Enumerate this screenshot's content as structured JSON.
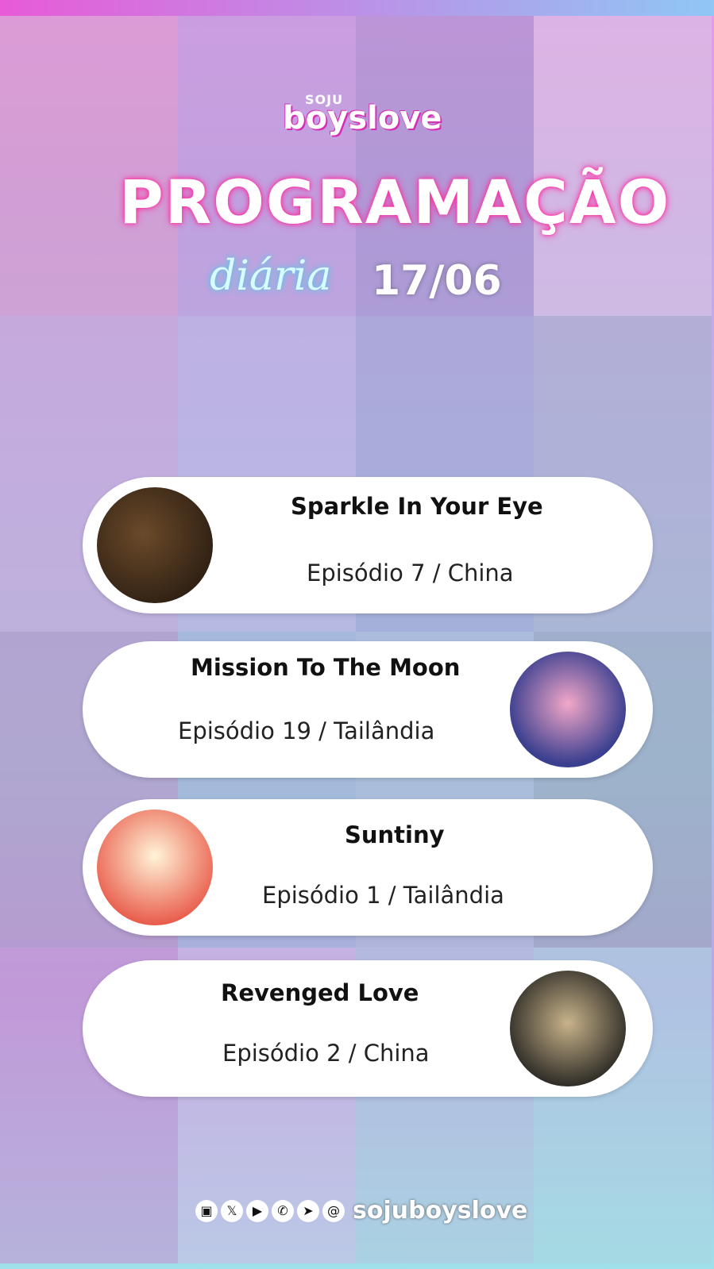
{
  "header": {
    "brand_small": "SOJU",
    "brand": "boyslove",
    "title": "PROGRAMAÇÃO",
    "subtitle": "diária",
    "date": "17/06"
  },
  "schedule": [
    {
      "show": "Sparkle In Your Eye",
      "episode": "Episódio 7 / China"
    },
    {
      "show": "Mission To The Moon",
      "episode": "Episódio 19 / Tailândia"
    },
    {
      "show": "Suntiny",
      "episode": "Episódio 1 / Tailândia"
    },
    {
      "show": "Revenged Love",
      "episode": "Episódio 2 / China"
    }
  ],
  "footer": {
    "icons": [
      "instagram-icon",
      "x-icon",
      "youtube-icon",
      "whatsapp-icon",
      "telegram-icon",
      "threads-icon"
    ],
    "handle": "sojuboyslove"
  },
  "colors": {
    "accent_pink": "#ff2ea4",
    "accent_cyan": "#2fd3e8",
    "card_bg": "#ffffff"
  }
}
